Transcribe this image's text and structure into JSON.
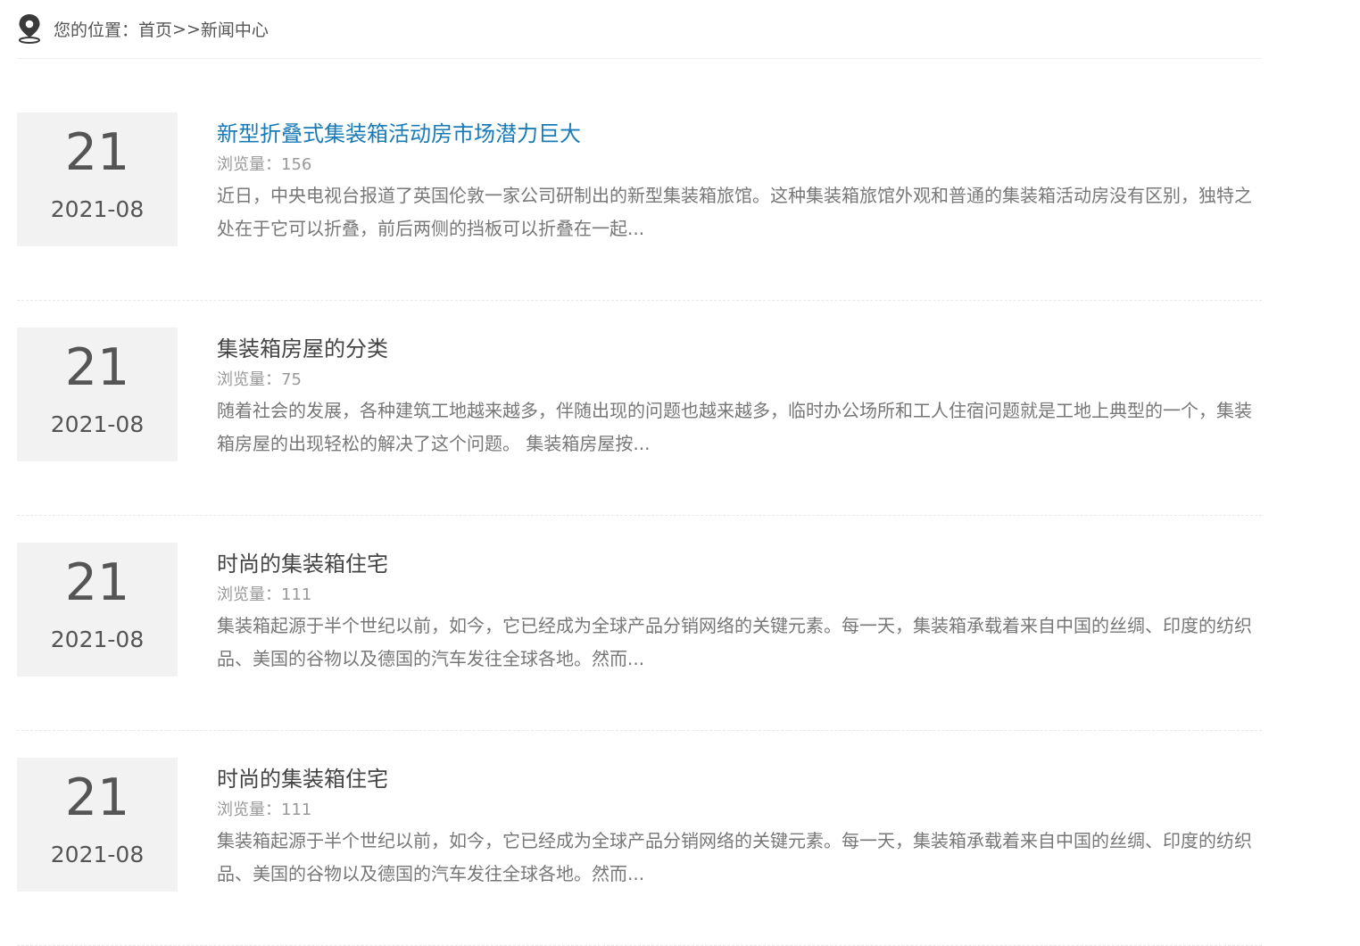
{
  "breadcrumb": {
    "icon": "location-pin-icon",
    "label": "您的位置：",
    "home": "首页",
    "separator": ">>",
    "current": "新闻中心"
  },
  "news": [
    {
      "day": "21",
      "year_month": "2021-08",
      "title": "新型折叠式集装箱活动房市场潜力巨大",
      "views_label": "浏览量：",
      "views": "156",
      "summary": "近日，中央电视台报道了英国伦敦一家公司研制出的新型集装箱旅馆。这种集装箱旅馆外观和普通的集装箱活动房没有区别，独特之处在于它可以折叠，前后两侧的挡板可以折叠在一起...",
      "highlighted": true
    },
    {
      "day": "21",
      "year_month": "2021-08",
      "title": "集装箱房屋的分类",
      "views_label": "浏览量：",
      "views": "75",
      "summary": "随着社会的发展，各种建筑工地越来越多，伴随出现的问题也越来越多，临时办公场所和工人住宿问题就是工地上典型的一个，集装箱房屋的出现轻松的解决了这个问题。 集装箱房屋按...",
      "highlighted": false
    },
    {
      "day": "21",
      "year_month": "2021-08",
      "title": "时尚的集装箱住宅",
      "views_label": "浏览量：",
      "views": "111",
      "summary": "集装箱起源于半个世纪以前，如今，它已经成为全球产品分销网络的关键元素。每一天，集装箱承载着来自中国的丝绸、印度的纺织品、美国的谷物以及德国的汽车发往全球各地。然而...",
      "highlighted": false
    },
    {
      "day": "21",
      "year_month": "2021-08",
      "title": "时尚的集装箱住宅",
      "views_label": "浏览量：",
      "views": "111",
      "summary": "集装箱起源于半个世纪以前，如今，它已经成为全球产品分销网络的关键元素。每一天，集装箱承载着来自中国的丝绸、印度的纺织品、美国的谷物以及德国的汽车发往全球各地。然而...",
      "highlighted": false
    }
  ],
  "colors": {
    "title_active": "#1a7bb6",
    "title": "#444444",
    "date_bg": "#f2f2f2",
    "meta": "#999999",
    "summary": "#777777"
  }
}
